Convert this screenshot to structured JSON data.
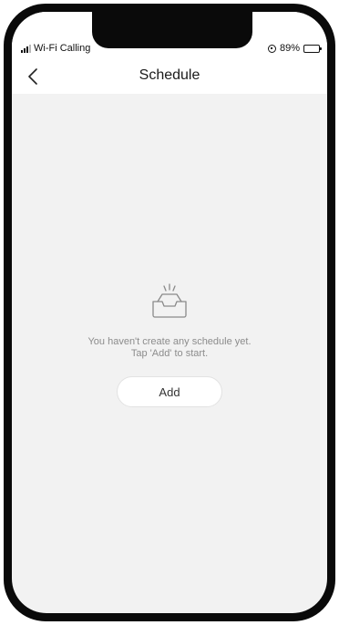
{
  "status_bar": {
    "carrier": "Wi-Fi Calling",
    "battery": "89%",
    "battery_level": 0.89
  },
  "header": {
    "title": "Schedule",
    "back_icon": "chevron-left-icon"
  },
  "empty_state": {
    "icon": "empty-tray-icon",
    "line1": "You haven't create any schedule yet.",
    "line2": "Tap 'Add' to start.",
    "add_label": "Add"
  }
}
